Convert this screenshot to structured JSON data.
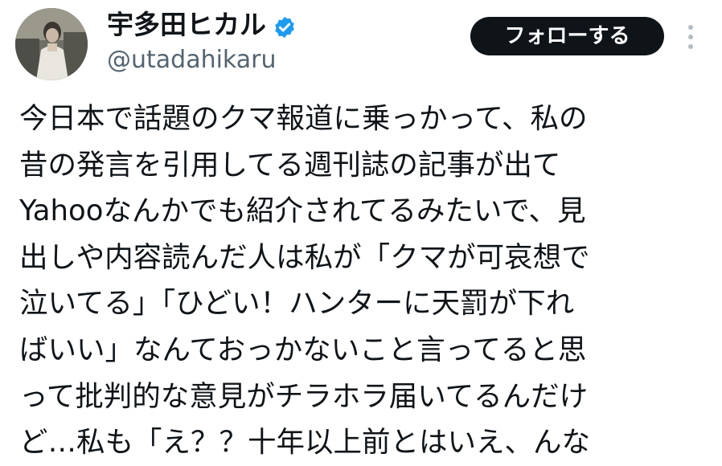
{
  "user": {
    "display_name": "宇多田ヒカル",
    "handle": "@utadahikaru",
    "verified_icon": "verified-badge-icon",
    "avatar_icon": "profile-photo"
  },
  "actions": {
    "follow_label": "フォローする",
    "more_icon": "more-vertical-icon"
  },
  "tweet": {
    "lines": [
      "今日本で話題のクマ報道に乗っかって、私の",
      "昔の発言を引用してる週刊誌の記事が出て",
      "Yahooなんかでも紹介されてるみたいで、見",
      "出しや内容読んだ人は私が「クマが可哀想で",
      "泣いてる」「ひどい！ハンターに天罰が下れ",
      "ばいい」なんておっかないこと言ってると思",
      "って批判的な意見がチラホラ届いてるんだけ",
      "ど…私も「え？？十年以上前とはいえ、んな"
    ]
  },
  "colors": {
    "text": "#0f1419",
    "secondary_text": "#536471",
    "verified": "#1d9bf0",
    "button_bg": "#0f1419"
  }
}
